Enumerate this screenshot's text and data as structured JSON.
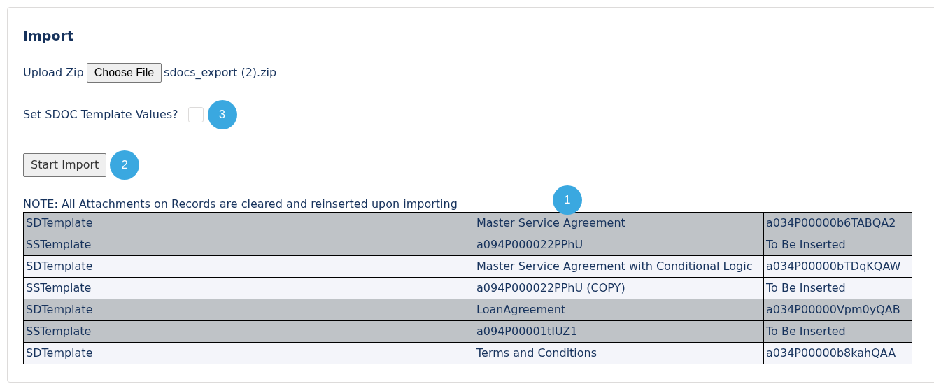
{
  "title": "Import",
  "upload": {
    "label": "Upload Zip",
    "button": "Choose File",
    "file_name": "sdocs_export (2).zip"
  },
  "template_values": {
    "label": "Set SDOC Template Values?",
    "checked": false,
    "badge": "3"
  },
  "start_button": {
    "label": "Start Import",
    "badge": "2"
  },
  "note": {
    "text": "NOTE: All Attachments on Records are cleared and reinserted upon importing",
    "badge": "1"
  },
  "rows": [
    {
      "cells": [
        "SDTemplate",
        "Master Service Agreement",
        "a034P00000b6TABQA2"
      ],
      "shaded": true
    },
    {
      "cells": [
        "SSTemplate",
        "a094P000022PPhU",
        "To Be Inserted"
      ],
      "shaded": true
    },
    {
      "cells": [
        "SDTemplate",
        "Master Service Agreement with Conditional Logic",
        "a034P00000bTDqKQAW"
      ],
      "shaded": false
    },
    {
      "cells": [
        "SSTemplate",
        "a094P000022PPhU (COPY)",
        "To Be Inserted"
      ],
      "shaded": false
    },
    {
      "cells": [
        "SDTemplate",
        "LoanAgreement",
        "a034P00000Vpm0yQAB"
      ],
      "shaded": true
    },
    {
      "cells": [
        "SSTemplate",
        "a094P00001tIUZ1",
        "To Be Inserted"
      ],
      "shaded": true
    },
    {
      "cells": [
        "SDTemplate",
        "Terms and Conditions",
        "a034P00000b8kahQAA"
      ],
      "shaded": false
    }
  ]
}
